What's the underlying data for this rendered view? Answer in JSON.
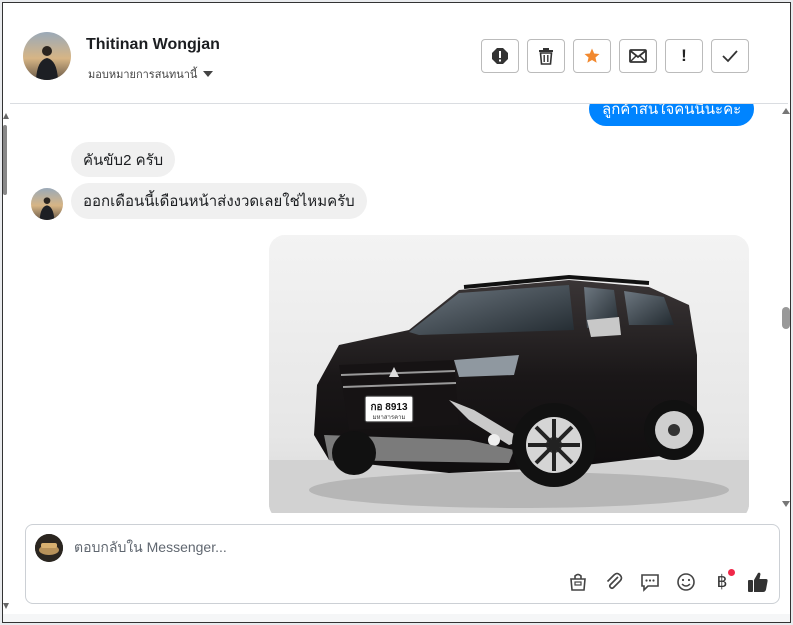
{
  "header": {
    "name": "Thitinan Wongjan",
    "assign_label": "มอบหมายการสนทนานี้",
    "actions": [
      "report-icon",
      "trash-icon",
      "star-icon",
      "mail-icon",
      "exclamation-icon",
      "check-icon"
    ],
    "exclamation_text": "!"
  },
  "messages": {
    "outgoing_partial": "ลูกค้าสนใจคนนี้นะคะ",
    "incoming_1": "คันขับ2 ครับ",
    "incoming_2": "ออกเดือนนี้เดือนหน้าส่งงวดเลยใช่ไหมครับ",
    "photo": {
      "plate_text": "กอ 8913",
      "plate_sub": "มหาสารคาม"
    }
  },
  "composer": {
    "placeholder": "ตอบกลับใน Messenger...",
    "value": "",
    "tools": [
      "shop-icon",
      "attach-icon",
      "chat-icon",
      "emoji-icon",
      "baht-icon",
      "like-icon"
    ],
    "baht_symbol": "฿"
  },
  "colors": {
    "messenger_blue": "#0084ff",
    "incoming_bubble": "#f0f0f0",
    "star_orange": "#f2892f",
    "notify_red": "#f02849"
  }
}
